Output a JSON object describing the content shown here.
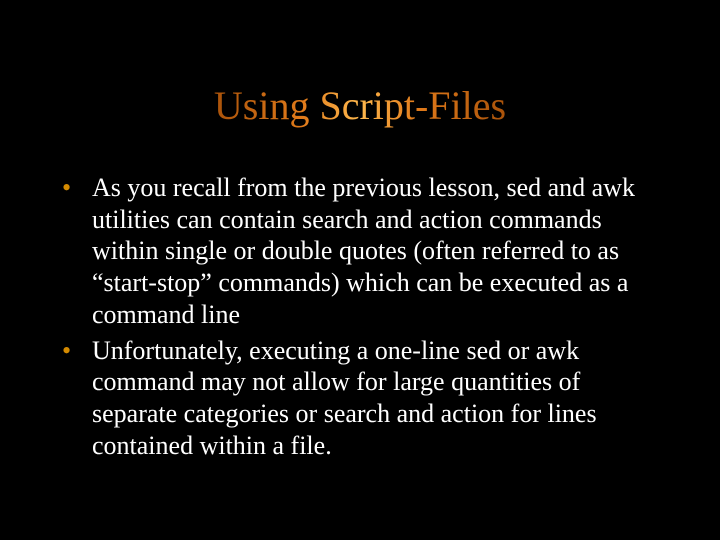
{
  "slide": {
    "title": "Using Script-Files",
    "bullets": [
      "As you recall from the previous lesson, sed and awk utilities can contain search and action commands within single or double quotes (often referred to as “start-stop” commands) which can be executed as a command line",
      "Unfortunately, executing a one-line sed or awk command may not allow for large quantities of separate categories or search and action for lines contained within a file."
    ]
  }
}
